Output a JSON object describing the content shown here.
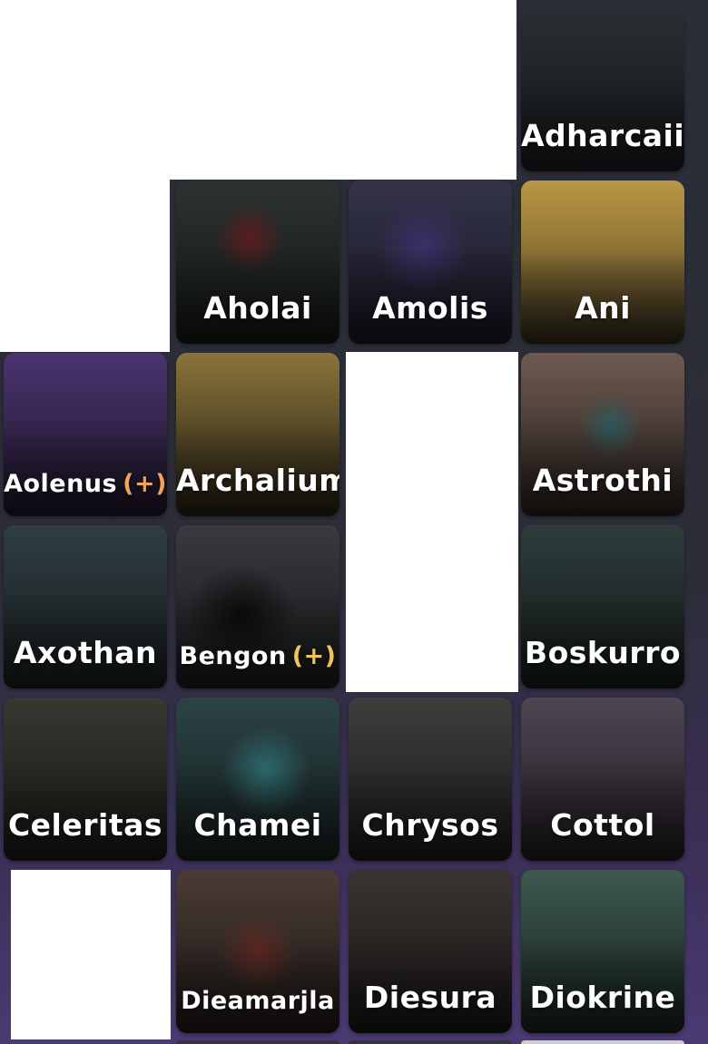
{
  "tiles": [
    {
      "name": "Adharcaiin",
      "plus": "",
      "top": "#2a2e31",
      "bottom": "#151719"
    },
    {
      "name": "Aholai",
      "plus": "",
      "top": "#2c3330",
      "bottom": "#121514"
    },
    {
      "name": "Amolis",
      "plus": "",
      "top": "#34334a",
      "bottom": "#141520"
    },
    {
      "name": "Ani",
      "plus": "",
      "top": "#b99746",
      "bottom": "#2a2416"
    },
    {
      "name": "Aolenus",
      "plus": "(+)",
      "top": "#4b3470",
      "bottom": "#1a1424"
    },
    {
      "name": "Archalium",
      "plus": "",
      "top": "#8a7439",
      "bottom": "#221d12"
    },
    {
      "name": "Astrothi",
      "plus": "",
      "top": "#6f5a51",
      "bottom": "#221c19"
    },
    {
      "name": "Axothan",
      "plus": "",
      "top": "#2f3e42",
      "bottom": "#151a1c"
    },
    {
      "name": "Bengon",
      "plus": "(+)",
      "top": "#383a3e",
      "bottom": "#161719"
    },
    {
      "name": "Boskurro",
      "plus": "",
      "top": "#2d3d3b",
      "bottom": "#121818"
    },
    {
      "name": "Celeritas",
      "plus": "",
      "top": "#383831",
      "bottom": "#161613"
    },
    {
      "name": "Chamei",
      "plus": "",
      "top": "#2c4445",
      "bottom": "#131b1c"
    },
    {
      "name": "Chrysos",
      "plus": "",
      "top": "#3e3e3d",
      "bottom": "#171717"
    },
    {
      "name": "Cottol",
      "plus": "",
      "top": "#4f4652",
      "bottom": "#1c181d"
    },
    {
      "name": "Dieamarjla",
      "plus": "",
      "top": "#4a3b35",
      "bottom": "#1b1615"
    },
    {
      "name": "Diesura",
      "plus": "",
      "top": "#3a3432",
      "bottom": "#161413"
    },
    {
      "name": "Diokrine",
      "plus": "",
      "top": "#3d5a4e",
      "bottom": "#141f1b"
    }
  ]
}
